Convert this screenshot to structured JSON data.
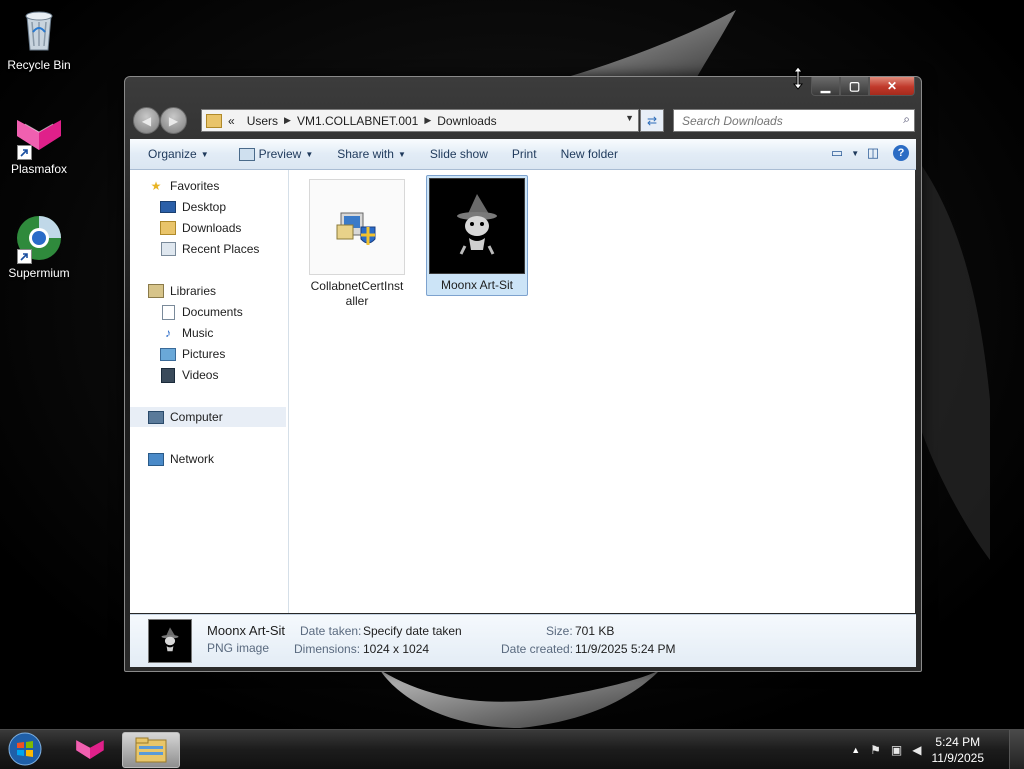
{
  "desktop": {
    "icons": [
      {
        "label": "Recycle Bin"
      },
      {
        "label": "Plasmafox"
      },
      {
        "label": "Supermium"
      }
    ]
  },
  "window": {
    "address": {
      "overflow": "«",
      "segments": [
        "Users",
        "VM1.COLLABNET.001",
        "Downloads"
      ]
    },
    "search": {
      "placeholder": "Search Downloads"
    },
    "toolbar": {
      "organize": "Organize",
      "preview": "Preview",
      "share_with": "Share with",
      "slide_show": "Slide show",
      "print": "Print",
      "new_folder": "New folder"
    },
    "nav_pane": {
      "favorites": "Favorites",
      "desktop": "Desktop",
      "downloads": "Downloads",
      "recent_places": "Recent Places",
      "libraries": "Libraries",
      "documents": "Documents",
      "music": "Music",
      "pictures": "Pictures",
      "videos": "Videos",
      "computer": "Computer",
      "network": "Network"
    },
    "files": [
      {
        "name": "CollabnetCertInst aller",
        "selected": false
      },
      {
        "name": "Moonx Art-Sit",
        "selected": true
      }
    ],
    "details": {
      "name": "Moonx Art-Sit",
      "type": "PNG image",
      "date_taken_label": "Date taken:",
      "date_taken_value": "Specify date taken",
      "dimensions_label": "Dimensions:",
      "dimensions_value": "1024 x 1024",
      "size_label": "Size:",
      "size_value": "701 KB",
      "date_created_label": "Date created:",
      "date_created_value": "11/9/2025 5:24 PM"
    }
  },
  "taskbar": {
    "clock_time": "5:24 PM",
    "clock_date": "11/9/2025"
  }
}
